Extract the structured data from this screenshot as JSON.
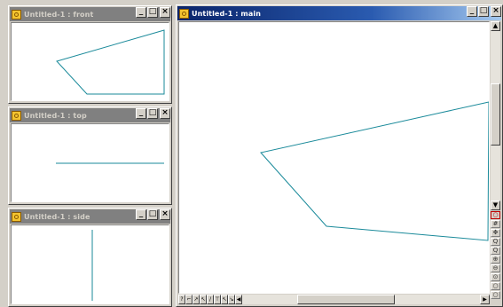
{
  "windows": {
    "front": {
      "title": "Untitled-1 : front"
    },
    "top": {
      "title": "Untitled-1 : top"
    },
    "side": {
      "title": "Untitled-1 : side"
    },
    "main": {
      "title": "Untitled-1 : main"
    }
  },
  "controls": {
    "minimize": "_",
    "maximize": "□",
    "close": "×"
  },
  "colors": {
    "line": "#1a8a9a",
    "active_title": "#0a246a",
    "inactive_title": "#808080"
  },
  "scroll": {
    "up": "▲",
    "down": "▼",
    "left": "◀",
    "right": "▶"
  },
  "nav_buttons": [
    "?",
    "⌐",
    "↗",
    "↖",
    "/",
    "⊤",
    "↖",
    "↘"
  ],
  "tools": [
    {
      "icon": "record-icon",
      "glyph": "○"
    },
    {
      "icon": "grid-icon",
      "glyph": "#"
    },
    {
      "icon": "move-icon",
      "glyph": "✥"
    },
    {
      "icon": "zoom-icon",
      "glyph": "Q"
    },
    {
      "icon": "zoom-extents-icon",
      "glyph": "Q"
    },
    {
      "icon": "zoom-in-icon",
      "glyph": "⊕"
    },
    {
      "icon": "zoom-out-icon",
      "glyph": "⊖"
    },
    {
      "icon": "zoom-window-icon",
      "glyph": "⊙"
    },
    {
      "icon": "pan-icon",
      "glyph": "○"
    },
    {
      "icon": "rotate-icon",
      "glyph": "○"
    }
  ]
}
